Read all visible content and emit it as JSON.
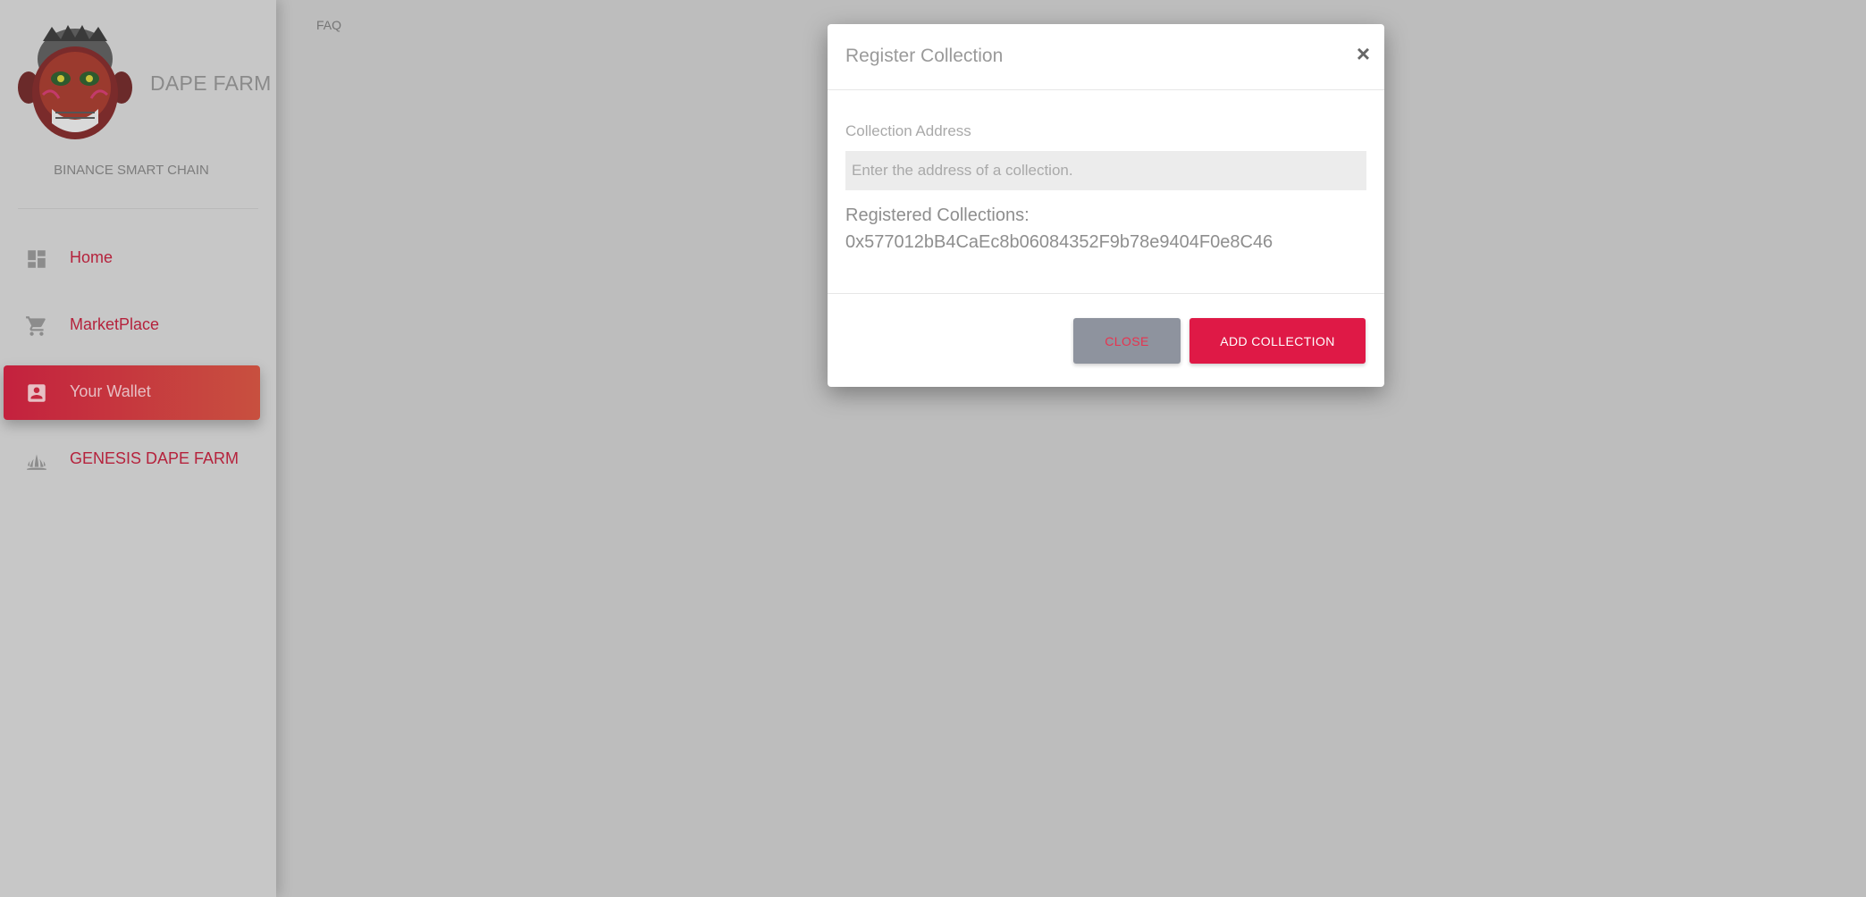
{
  "sidebar": {
    "brand_name": "DAPE FARM",
    "network": "BINANCE SMART CHAIN",
    "items": [
      {
        "label": "Home",
        "icon": "dashboard-icon",
        "active": false
      },
      {
        "label": "MarketPlace",
        "icon": "shopping-cart-icon",
        "active": false
      },
      {
        "label": "Your Wallet",
        "icon": "account-box-icon",
        "active": true
      },
      {
        "label": "GENESIS DAPE FARM",
        "icon": "grass-icon",
        "active": false
      }
    ]
  },
  "header": {
    "faq_label": "FAQ"
  },
  "modal": {
    "title": "Register Collection",
    "close_symbol": "×",
    "field_label": "Collection Address",
    "input_placeholder": "Enter the address of a collection.",
    "input_value": "",
    "registered_label": "Registered Collections:",
    "registered_address": "0x577012bB4CaEc8b06084352F9b78e9404F0e8C46",
    "close_button": "CLOSE",
    "add_button": "ADD COLLECTION"
  },
  "colors": {
    "accent": "#df1946",
    "nav_text": "#b5223c",
    "backdrop": "#bdbdbd"
  }
}
